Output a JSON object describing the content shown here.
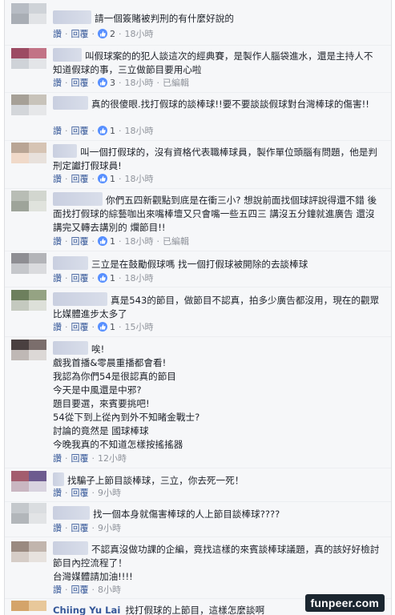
{
  "labels": {
    "reply": "讚",
    "reply2": "回覆",
    "edited": "已編輯"
  },
  "comments": [
    {
      "text": "請一個簽賭被判刑的有什麼好說的",
      "likes": "2",
      "time": "18小時",
      "edited": false
    },
    {
      "text": "叫假球案的的犯人談這次的經典賽，是製作人腦袋進水，還是主持人不知道假球的事，三立做節目要用心啦",
      "likes": "3",
      "time": "18小時",
      "edited": true
    },
    {
      "text": "真的很傻眼.找打假球的談棒球!!要不要談談假球對台灣棒球的傷害!!",
      "likes": "1",
      "time": "18小時",
      "edited": false
    },
    {
      "text": "叫一個打假球的，沒有資格代表職棒球員，製作單位頭腦有問題，他是判刑定讞打假球員!",
      "likes": "1",
      "time": "18小時",
      "edited": false
    },
    {
      "text": "你們五四新觀點到底是在衝三小? 想說前面找個球評說得還不錯 後面找打假球的綜藝咖出來嘴棒壇又只會嘴一些五四三 講沒五分鐘就進廣告 還沒講完又轉去講別的 爛節目!!",
      "likes": "1",
      "time": "18小時",
      "edited": true
    },
    {
      "text": "三立是在鼓勵假球嗎 找一個打假球被開除的去談棒球",
      "likes": "1",
      "time": "18小時",
      "edited": false
    },
    {
      "text": "真是543的節目，做節目不認真，拍多少廣告都沒用，現在的觀眾比媒體進步太多了",
      "likes": "1",
      "time": "15小時",
      "edited": false
    },
    {
      "text": "唉!\n戲我首播&零晨重播都會看!\n我認為你們54是很認真的節目\n今天是中風還是中邪?\n題目要選，來賓要挑吧!\n54從下到上從內到外不知睹金戰士?\n討論的竟然是 國球棒球\n今晚我真的不知道怎樣按搖搖器",
      "likes": "",
      "time": "12小時",
      "edited": false
    },
    {
      "text": "找騙子上節目談棒球，三立，你去死一死！",
      "likes": "",
      "time": "9小時",
      "edited": false
    },
    {
      "text": "找一個本身就傷害棒球的人上節目談棒球????",
      "likes": "",
      "time": "9小時",
      "edited": false
    },
    {
      "text": "不認真沒做功課的企編，竟找這樣的來賓談棒球議題，真的該好好檢討節目內控流程了！\n台灣媒體請加油!!!!",
      "likes": "",
      "time": "8小時",
      "edited": false
    },
    {
      "name": "Chiing Yu Lai",
      "text": "找打假球的上節目，這樣怎麼談啊",
      "likes": "",
      "time": "",
      "edited": false
    }
  ],
  "watermark": "funpeer.com",
  "colors": {
    "link": "#365899",
    "like_blue": "#5890ff",
    "meta_gray": "#90949c"
  }
}
